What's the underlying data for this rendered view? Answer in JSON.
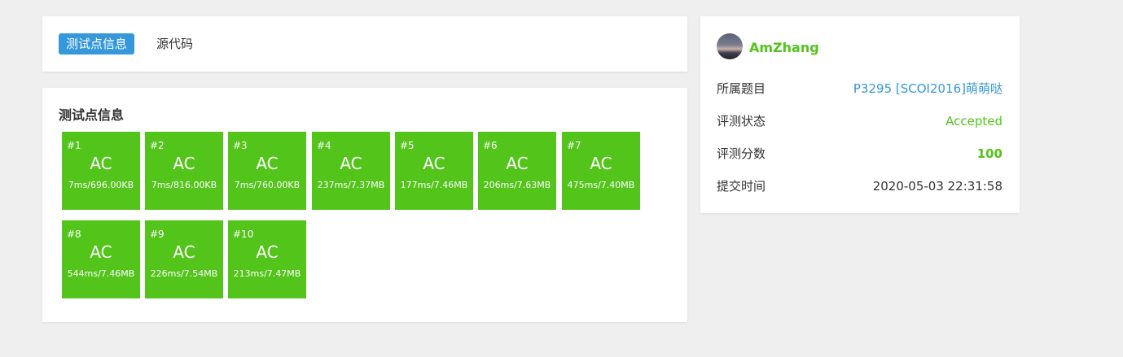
{
  "tabs": {
    "active": "测试点信息",
    "source": "源代码"
  },
  "tests": {
    "title": "测试点信息",
    "cases": [
      {
        "id": "#1",
        "status": "AC",
        "detail": "7ms/696.00KB"
      },
      {
        "id": "#2",
        "status": "AC",
        "detail": "7ms/816.00KB"
      },
      {
        "id": "#3",
        "status": "AC",
        "detail": "7ms/760.00KB"
      },
      {
        "id": "#4",
        "status": "AC",
        "detail": "237ms/7.37MB"
      },
      {
        "id": "#5",
        "status": "AC",
        "detail": "177ms/7.46MB"
      },
      {
        "id": "#6",
        "status": "AC",
        "detail": "206ms/7.63MB"
      },
      {
        "id": "#7",
        "status": "AC",
        "detail": "475ms/7.40MB"
      },
      {
        "id": "#8",
        "status": "AC",
        "detail": "544ms/7.46MB"
      },
      {
        "id": "#9",
        "status": "AC",
        "detail": "226ms/7.54MB"
      },
      {
        "id": "#10",
        "status": "AC",
        "detail": "213ms/7.47MB"
      }
    ]
  },
  "info": {
    "username": "AmZhang",
    "rows": [
      {
        "label": "所属题目",
        "value": "P3295 [SCOI2016]萌萌哒"
      },
      {
        "label": "评测状态",
        "value": "Accepted"
      },
      {
        "label": "评测分数",
        "value": "100"
      },
      {
        "label": "提交时间",
        "value": "2020-05-03 22:31:58"
      }
    ]
  },
  "colors": {
    "accent": "#3498db",
    "ac_green": "#52c41a",
    "background": "#efefef"
  }
}
